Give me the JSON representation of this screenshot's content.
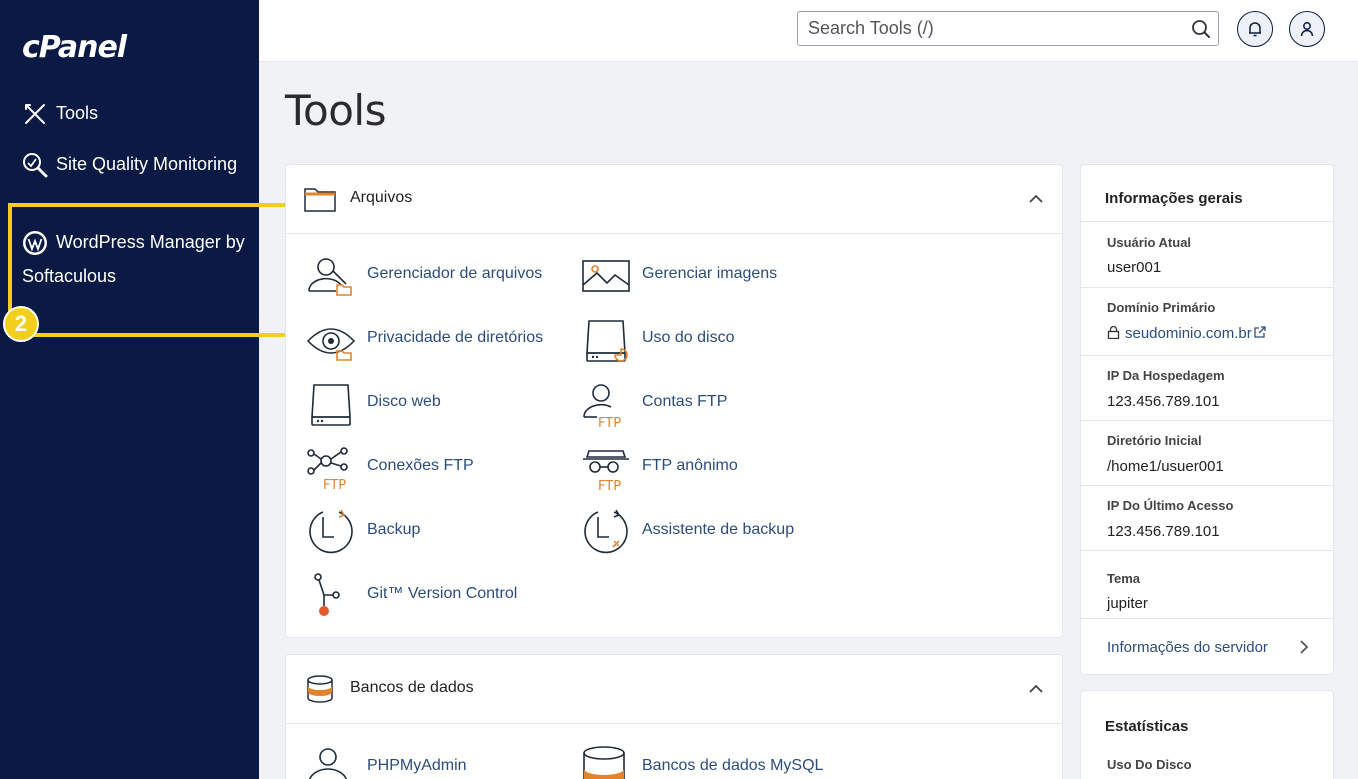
{
  "brand": {
    "logo_text": "cPanel"
  },
  "sidebar": {
    "items": [
      {
        "label": "Tools",
        "icon": "tools-icon"
      },
      {
        "label": "Site Quality Monitoring",
        "icon": "site-quality-icon"
      },
      {
        "label": "WordPress Manager by Softaculous",
        "icon": "wordpress-icon"
      }
    ],
    "highlight_badge": "2"
  },
  "header": {
    "search_placeholder": "Search Tools (/)",
    "notifications_icon": "bell-icon",
    "user_icon": "user-icon"
  },
  "page": {
    "title": "Tools"
  },
  "panels": {
    "files": {
      "title": "Arquivos",
      "tools": [
        {
          "label": "Gerenciador de arquivos",
          "icon": "file-manager-icon"
        },
        {
          "label": "Gerenciar imagens",
          "icon": "images-icon"
        },
        {
          "label": "Privacidade de diretórios",
          "icon": "directory-privacy-icon"
        },
        {
          "label": "Uso do disco",
          "icon": "disk-usage-icon"
        },
        {
          "label": "Disco web",
          "icon": "web-disk-icon"
        },
        {
          "label": "Contas FTP",
          "icon": "ftp-accounts-icon"
        },
        {
          "label": "Conexões FTP",
          "icon": "ftp-connections-icon"
        },
        {
          "label": "FTP anônimo",
          "icon": "anonymous-ftp-icon"
        },
        {
          "label": "Backup",
          "icon": "backup-icon"
        },
        {
          "label": "Assistente de backup",
          "icon": "backup-wizard-icon"
        },
        {
          "label": "Git™ Version Control",
          "icon": "git-icon"
        }
      ],
      "ftp_tag": "FTP"
    },
    "databases": {
      "title": "Bancos de dados",
      "tools": [
        {
          "label": "PHPMyAdmin",
          "icon": "phpmyadmin-icon"
        },
        {
          "label": "Bancos de dados MySQL",
          "icon": "mysql-icon"
        }
      ]
    }
  },
  "general_info": {
    "title": "Informações gerais",
    "rows": [
      {
        "label": "Usuário Atual",
        "value": "user001"
      },
      {
        "label": "Domínio Primário",
        "value": "seudominio.com.br"
      },
      {
        "label": "IP Da Hospedagem",
        "value": "123.456.789.101"
      },
      {
        "label": "Diretório Inicial",
        "value": "/home1/usuer001"
      },
      {
        "label": "IP Do Último Acesso",
        "value": "123.456.789.101"
      },
      {
        "label": "Tema",
        "value": "jupiter"
      }
    ],
    "server_info_link": "Informações do servidor"
  },
  "statistics": {
    "title": "Estatísticas",
    "first_item": "Uso Do Disco"
  },
  "colors": {
    "sidebar_bg": "#0a1a44",
    "highlight": "#f2cf1d",
    "link": "#2b4d7d",
    "icon_accent": "#e3832b"
  }
}
